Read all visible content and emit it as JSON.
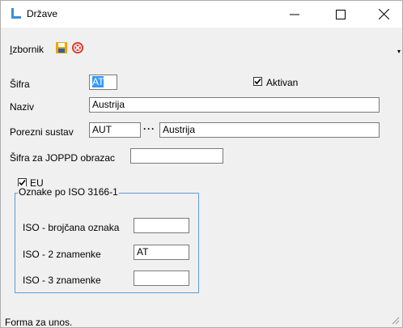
{
  "window": {
    "title": "Države",
    "icon": "form-icon",
    "controls": {
      "minimize": "minimize-icon",
      "maximize": "maximize-icon",
      "close": "close-icon"
    }
  },
  "menu": {
    "izbornik_first": "I",
    "izbornik_rest": "zbornik",
    "save_icon": "save-icon",
    "cancel_icon": "cancel-icon"
  },
  "form": {
    "sifra_label": "Šifra",
    "sifra_value": "AT",
    "aktivan_label": "Aktivan",
    "aktivan_checked": true,
    "naziv_label": "Naziv",
    "naziv_value": "Austrija",
    "porezni_label": "Porezni sustav",
    "porezni_code": "AUT",
    "porezni_button": "···",
    "porezni_name": "Austrija",
    "joppd_label": "Šifra za JOPPD obrazac",
    "joppd_value": "",
    "eu_label": "EU",
    "eu_checked": true
  },
  "iso": {
    "group_title": "Oznake po ISO 3166-1",
    "brojcana_label": "ISO - brojčana oznaka",
    "brojcana_value": "",
    "two_label": "ISO - 2 znamenke",
    "two_value": "AT",
    "three_label": "ISO - 3 znamenke",
    "three_value": ""
  },
  "status": {
    "text": "Forma za unos."
  },
  "colors": {
    "groupbox_border": "#5b9bd5",
    "selection": "#3399ff",
    "save_icon": "#f0a500",
    "cancel_icon": "#d9342b"
  }
}
